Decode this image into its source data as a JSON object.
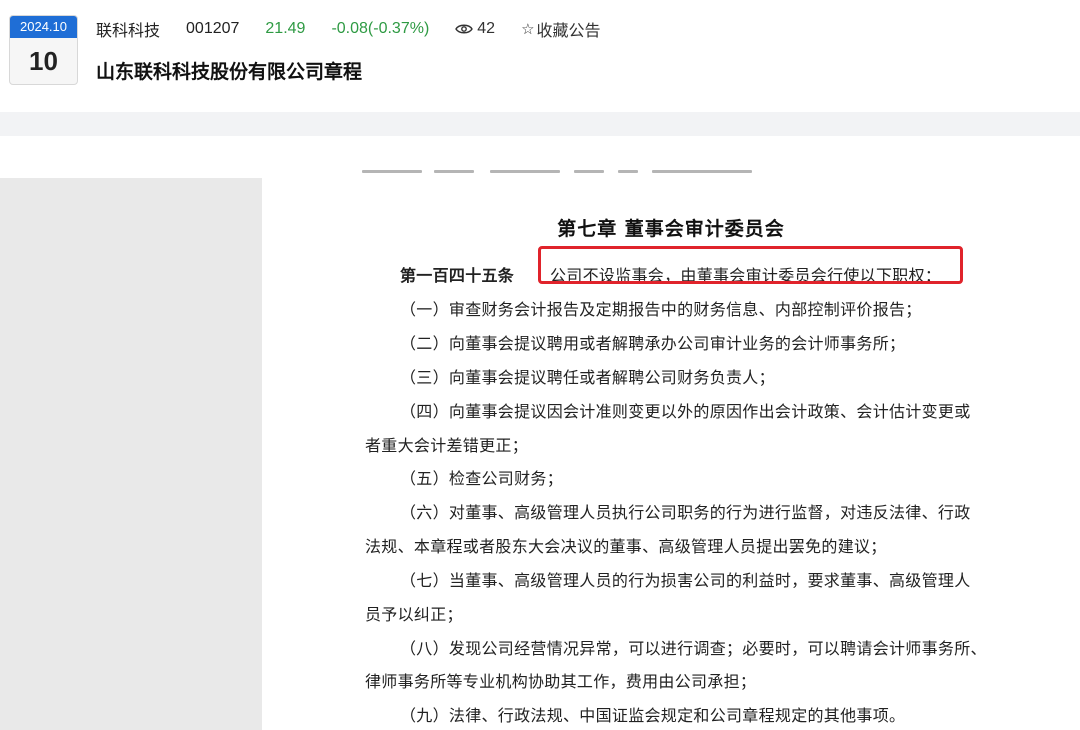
{
  "header": {
    "date_ym": "2024.10",
    "date_day": "10",
    "stock_name": "联科科技",
    "stock_code": "001207",
    "price": "21.49",
    "change": "-0.08(-0.37%)",
    "views": "42",
    "favorite_label": "收藏公告",
    "doc_title": "山东联科科技股份有限公司章程"
  },
  "document": {
    "chapter_title": "第七章  董事会审计委员会",
    "article_label": "第一百四十五条",
    "article_text": "公司不设监事会，由董事会审计委员会行使以下职权：",
    "lines": [
      "（一）审查财务会计报告及定期报告中的财务信息、内部控制评价报告；",
      "（二）向董事会提议聘用或者解聘承办公司审计业务的会计师事务所；",
      "（三）向董事会提议聘任或者解聘公司财务负责人；",
      "（四）向董事会提议因会计准则变更以外的原因作出会计政策、会计估计变更或",
      "者重大会计差错更正；",
      "（五）检查公司财务；",
      "（六）对董事、高级管理人员执行公司职务的行为进行监督，对违反法律、行政",
      "法规、本章程或者股东大会决议的董事、高级管理人员提出罢免的建议；",
      "（七）当董事、高级管理人员的行为损害公司的利益时，要求董事、高级管理人",
      "员予以纠正；",
      "（八）发现公司经营情况异常，可以进行调查；必要时，可以聘请会计师事务所、",
      "律师事务所等专业机构协助其工作，费用由公司承担；",
      "（九）法律、行政法规、中国证监会规定和公司章程规定的其他事项。"
    ]
  },
  "colors": {
    "accent": "#1f6ed6",
    "price_green": "#2e9a43",
    "highlight_red": "#e0232b"
  },
  "icons": {
    "views": "eye-icon",
    "favorite": "star-outline-icon"
  }
}
